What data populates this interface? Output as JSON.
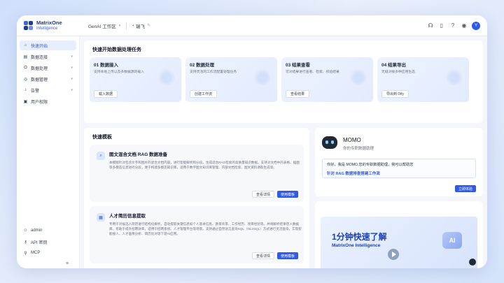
{
  "app": {
    "logo_line1": "MatrixOne",
    "logo_line2": "Intelligence",
    "workspace": "GenAI 工作区",
    "user_crumb": "瑞飞",
    "avatar": "Y"
  },
  "sidebar": {
    "items": [
      {
        "label": "快速开始",
        "icon": "home-icon",
        "active": true
      },
      {
        "label": "数据连接",
        "icon": "link-icon"
      },
      {
        "label": "数据处理",
        "icon": "flow-icon"
      },
      {
        "label": "数据管理",
        "icon": "database-icon"
      },
      {
        "label": "告警",
        "icon": "bell-icon"
      },
      {
        "label": "用户权限",
        "icon": "user-group-icon"
      }
    ],
    "bottom": [
      {
        "label": "admin",
        "icon": "user-icon"
      },
      {
        "label": "API 密钥",
        "icon": "key-icon"
      },
      {
        "label": "MCP",
        "icon": "plug-icon"
      }
    ]
  },
  "quick_start": {
    "title": "快速开始数据处理任务",
    "steps": [
      {
        "title": "01 数据接入",
        "desc": "支持本地上传以及多数据源的载入",
        "button": "载入数据"
      },
      {
        "title": "02 数据处理",
        "desc": "支持灵活的工作流配置处理任务",
        "button": "创建工作流"
      },
      {
        "title": "03 结果查看",
        "desc": "可对结果进行查看、检索、校验结果",
        "button": "查看结果"
      },
      {
        "title": "04 结果导出",
        "desc": "无缝对接多种应用生态",
        "button": "导出到 Dify"
      }
    ]
  },
  "templates": {
    "title": "快速模板",
    "items": [
      {
        "title": "图文混合文档 RAG 数据准备",
        "desc": "本模版针对包含文字和图片的混合文档内容，进行智能解析和分段。生成适合RAG检索的高质量知识数据。支持对文档中的表格、插图等多模态信息进行分段，便于构建多模态知识库。适用于数字图文知识库管理、内部文档检索、图文资料调取生成等。",
        "view": "查看详情",
        "use": "使用模板"
      },
      {
        "title": "人才简历信息提取",
        "desc": "专用于对候选人简历进行结构化解析，自动提取关键信息如个人基本信息、教育背景、工作经历、项目经验等。并将解析结果存入数据库。有助于提升招聘效率，适用于招聘系统、人才管理平台等场景。支持通过自然语言查询SQL（NL2SQL）方式进行灵活查询，实现智能搜人、人才画像分析、简历比对等下游AI应用。",
        "view": "查看详情",
        "use": "使用模板"
      }
    ]
  },
  "momo": {
    "name": "MOMO",
    "subtitle": "你的专职数据助理",
    "greeting": "你好，我是 MOMO,您的专职数据助理，我可以帮助您",
    "link": "针对 RAG 数据排查搭建工作流",
    "button": "立即体验"
  },
  "promo": {
    "title": "1分钟快速了解",
    "subtitle": "MatrixOne Intelligence",
    "badge": "AI"
  }
}
